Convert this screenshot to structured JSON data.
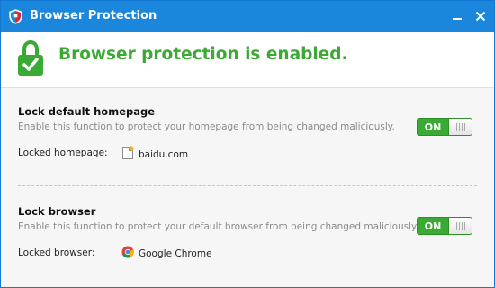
{
  "window": {
    "title": "Browser Protection",
    "minimize_icon": "minimize-icon",
    "close_icon": "close-icon"
  },
  "status": {
    "message": "Browser protection is enabled.",
    "icon": "lock-check-icon",
    "color": "#3aaa35"
  },
  "homepage": {
    "title": "Lock default homepage",
    "description": "Enable this function to protect your homepage from being changed maliciously.",
    "toggle_label": "ON",
    "locked_label": "Locked homepage:",
    "locked_value": "baidu.com",
    "locked_icon": "page-icon"
  },
  "browser": {
    "title": "Lock browser",
    "description": "Enable this function to protect your default browser from being changed maliciously.",
    "toggle_label": "ON",
    "locked_label": "Locked browser:",
    "locked_value": "Google Chrome",
    "locked_icon": "chrome-icon"
  },
  "colors": {
    "titlebar": "#1a86dc",
    "toggle": "#3aaa35"
  }
}
